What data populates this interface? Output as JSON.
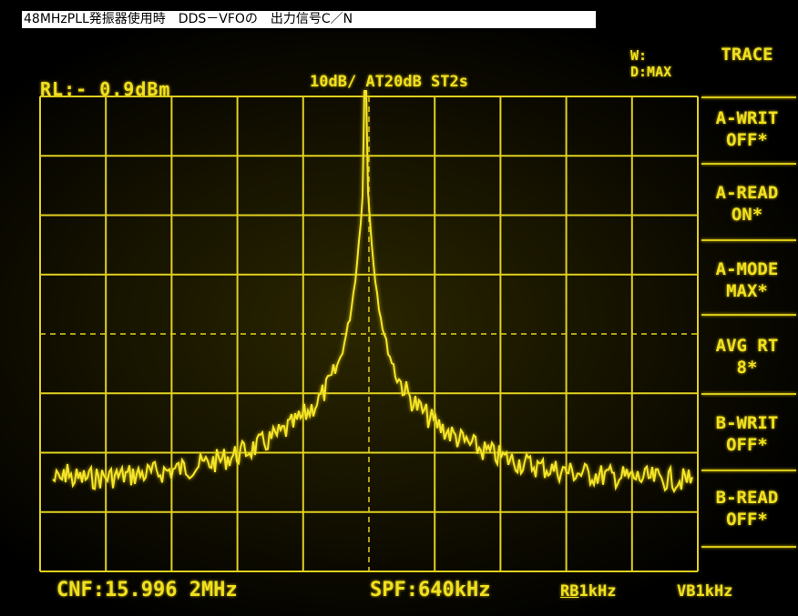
{
  "title": "48MHzPLL発振器使用時　DDS－VFOの　出力信号C／N",
  "header": {
    "ref_level": "RL:-  0.9dBm",
    "scale": "10dB/ AT20dB ST2s",
    "w_label": "W:",
    "d_label": "D:MAX"
  },
  "menu": [
    {
      "line1": "TRACE",
      "line2": ""
    },
    {
      "line1": "A-WRIT",
      "line2": "OFF*"
    },
    {
      "line1": "A-READ",
      "line2": "ON*"
    },
    {
      "line1": "A-MODE",
      "line2": "MAX*"
    },
    {
      "line1": "AVG RT",
      "line2": "8*"
    },
    {
      "line1": "B-WRIT",
      "line2": "OFF*"
    },
    {
      "line1": "B-READ",
      "line2": "OFF*"
    }
  ],
  "footer": {
    "center_freq": "CNF:15.996 2MHz",
    "span": "SPF:640kHz",
    "rbw_prefix": "RB",
    "rbw_value": "1kHz",
    "vbw": "VB1kHz"
  },
  "colors": {
    "trace": "#f5e52a",
    "grid": "#e0d020"
  }
}
